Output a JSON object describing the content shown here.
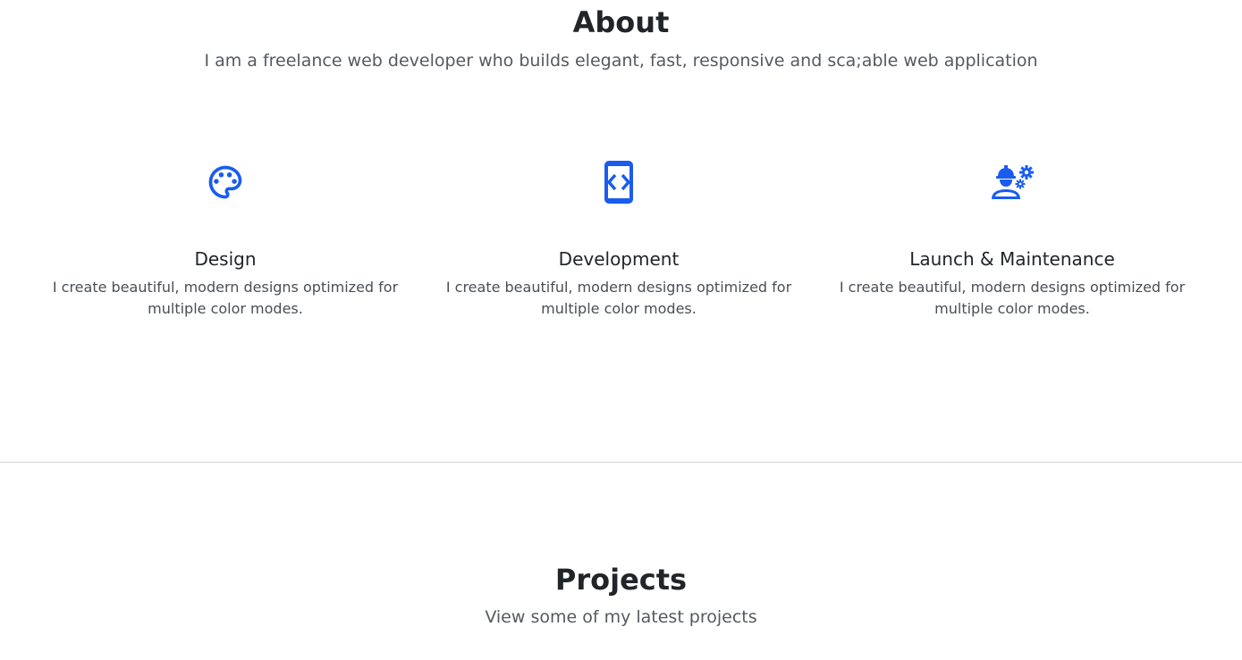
{
  "colors": {
    "accent": "#1a5cf0",
    "heading": "#212529",
    "subtext": "#555a60",
    "divider": "#cfd3d7"
  },
  "about": {
    "title": "About",
    "subtitle": "I am a freelance web developer who builds elegant, fast, responsive and sca;able web application",
    "services": [
      {
        "icon": "palette-icon",
        "title": "Design",
        "text": "I create beautiful, modern designs optimized for multiple color modes."
      },
      {
        "icon": "code-device-icon",
        "title": "Development",
        "text": "I create beautiful, modern designs optimized for multiple color modes."
      },
      {
        "icon": "engineer-gears-icon",
        "title": "Launch & Maintenance",
        "text": "I create beautiful, modern designs optimized for multiple color modes."
      }
    ]
  },
  "projects": {
    "title": "Projects",
    "subtitle": "View some of my latest projects"
  }
}
